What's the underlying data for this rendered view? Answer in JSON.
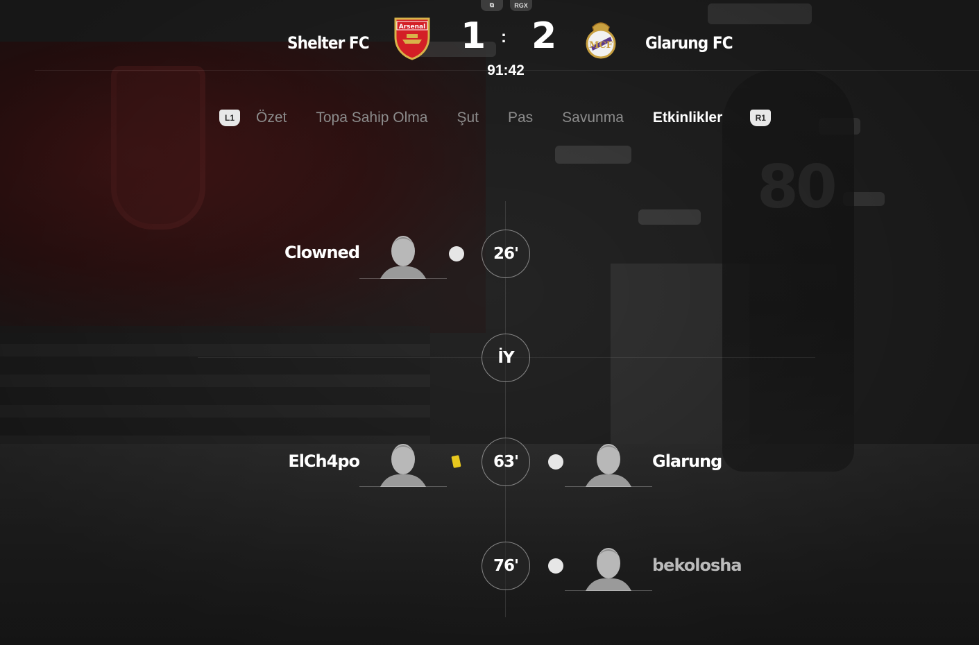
{
  "header": {
    "top_icons": [
      "share-icon",
      "RGX"
    ],
    "home": {
      "name": "Shelter FC",
      "score": "1",
      "crest_text": "Arsenal"
    },
    "away": {
      "name": "Glarung FC",
      "score": "2"
    },
    "separator": ":",
    "clock": "91:42"
  },
  "tabs": {
    "left_shoulder": "L1",
    "right_shoulder": "R1",
    "items": [
      "Özet",
      "Topa Sahip Olma",
      "Şut",
      "Pas",
      "Savunma",
      "Etkinlikler"
    ],
    "active_index": 5
  },
  "timeline": {
    "events": [
      {
        "minute": "26'",
        "side": "home",
        "player": "Clowned",
        "icon": "goal-ball-icon"
      },
      {
        "minute": "İY",
        "side": "none",
        "player": "",
        "icon": ""
      },
      {
        "minute": "63'",
        "home_player": "ElCh4po",
        "home_icon": "yellow-card-icon",
        "away_player": "Glarung",
        "away_icon": "goal-ball-icon"
      },
      {
        "minute": "76'",
        "side": "away",
        "player": "bekolosha",
        "icon": "goal-ball-icon"
      }
    ]
  },
  "colors": {
    "active_tab": "#ffffff",
    "inactive_tab": "#8c8c8c",
    "yellow_card": "#e8c81e"
  }
}
